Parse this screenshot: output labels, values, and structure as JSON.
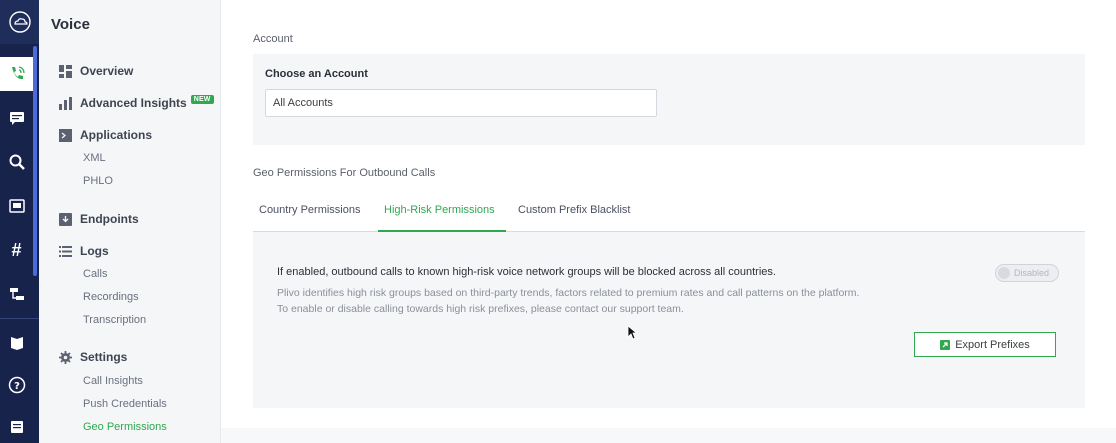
{
  "rail": {
    "icons": [
      "cloud-icon",
      "phone-icon",
      "message-icon",
      "search-icon",
      "sms-icon",
      "hash-icon",
      "flow-icon",
      "book-icon",
      "help-icon",
      "inbox-icon"
    ]
  },
  "subnav": {
    "title": "Voice",
    "overview": "Overview",
    "advanced_insights": "Advanced Insights",
    "new_badge": "NEW",
    "applications": "Applications",
    "xml": "XML",
    "phlo": "PHLO",
    "endpoints": "Endpoints",
    "logs": "Logs",
    "calls": "Calls",
    "recordings": "Recordings",
    "transcription": "Transcription",
    "settings": "Settings",
    "call_insights": "Call Insights",
    "push_credentials": "Push Credentials",
    "geo_permissions": "Geo Permissions"
  },
  "main": {
    "account_label": "Account",
    "choose_account": "Choose an Account",
    "account_value": "All Accounts",
    "geo_label": "Geo Permissions For Outbound Calls",
    "tabs": [
      "Country Permissions",
      "High-Risk Permissions",
      "Custom Prefix Blacklist"
    ],
    "headline": "If enabled, outbound calls to known high-risk voice network groups will be blocked across all countries.",
    "desc1": "Plivo identifies high risk groups based on third-party trends, factors related to premium rates and call patterns on the platform.",
    "desc2": "To enable or disable calling towards high risk prefixes, please contact our support team.",
    "toggle_label": "Disabled",
    "export_label": "Export Prefixes"
  },
  "colors": {
    "accent": "#2fa84f",
    "rail": "#17234b"
  }
}
